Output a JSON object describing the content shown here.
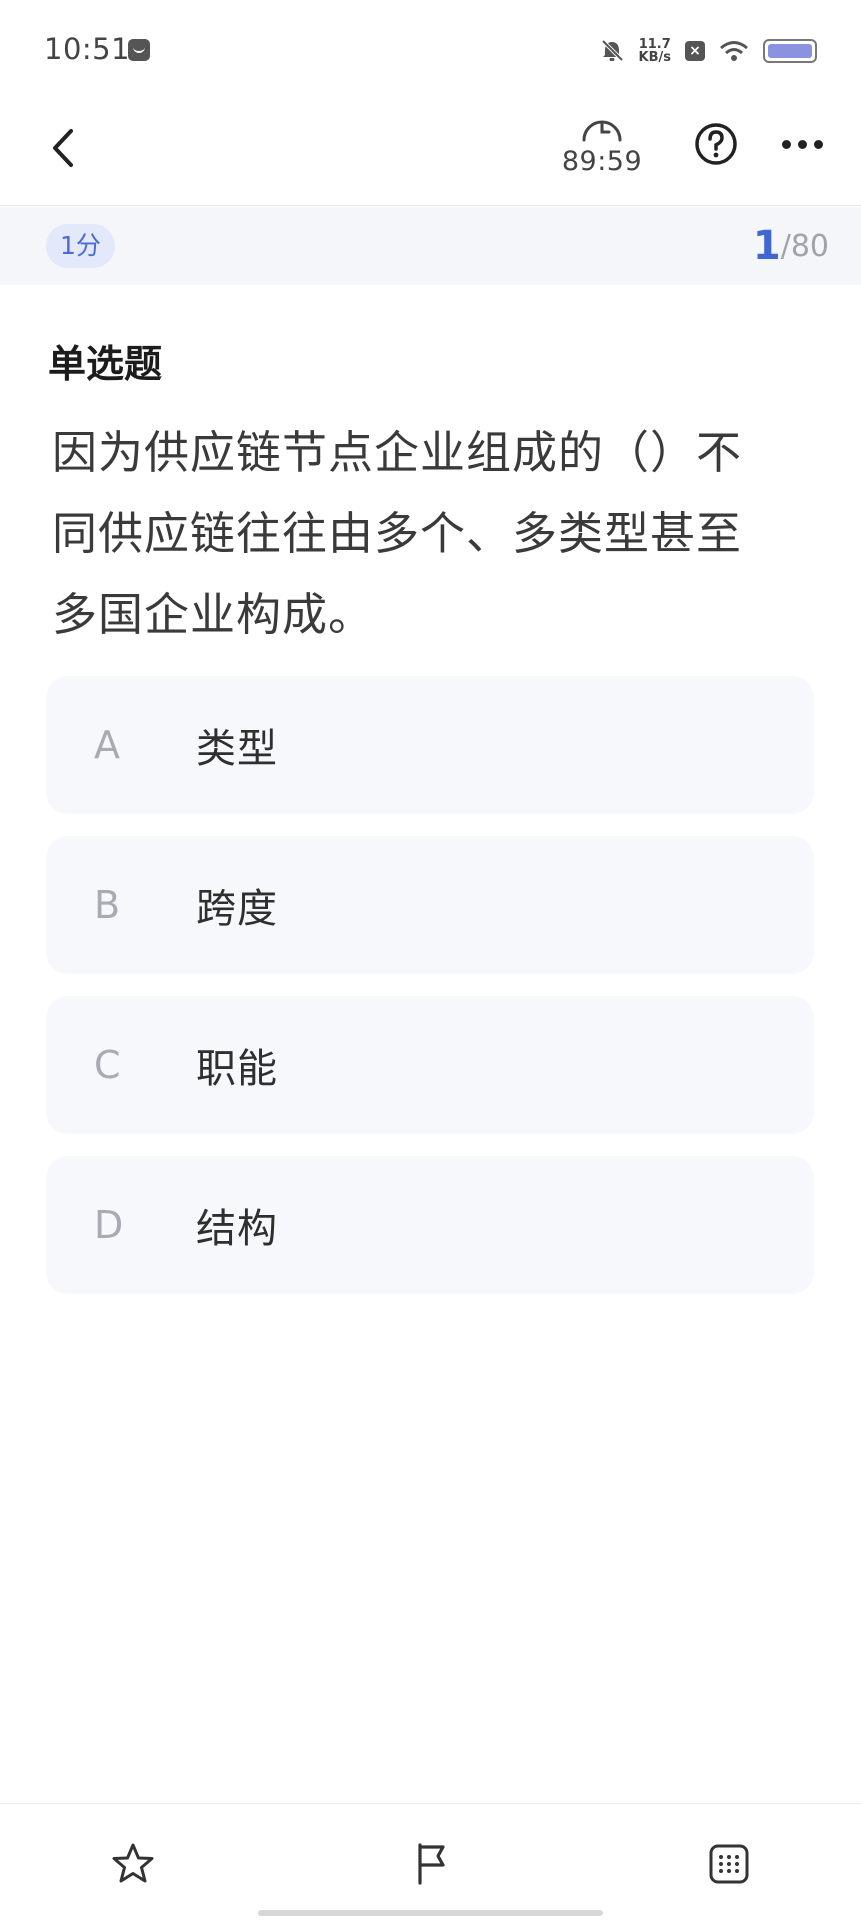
{
  "status_bar": {
    "time": "10:51",
    "net_speed_value": "11.7",
    "net_speed_unit": "KB/s",
    "icons": [
      "message-icon",
      "mute-bell-icon",
      "close-square-icon",
      "wifi-icon",
      "battery-icon"
    ]
  },
  "app_bar": {
    "timer": "89:59",
    "icons": [
      "back-icon",
      "clock-icon",
      "help-icon",
      "more-icon"
    ]
  },
  "info_bar": {
    "score": "1分",
    "current": "1",
    "total": "/80"
  },
  "question": {
    "type": "单选题",
    "line1": "因为供应链节点企业组成的（）不",
    "line2": "同供应链往往由多个、多类型甚至",
    "line3": "多国企业构成。"
  },
  "options": [
    {
      "letter": "A",
      "text": "类型"
    },
    {
      "letter": "B",
      "text": "跨度"
    },
    {
      "letter": "C",
      "text": "职能"
    },
    {
      "letter": "D",
      "text": "结构"
    }
  ],
  "bottom_bar": {
    "icons": [
      "star-icon",
      "flag-icon",
      "grid-icon"
    ]
  },
  "colors": {
    "accent": "#3f66d3",
    "badge_bg": "#e3e9fb",
    "option_bg": "#f7f8fb"
  }
}
